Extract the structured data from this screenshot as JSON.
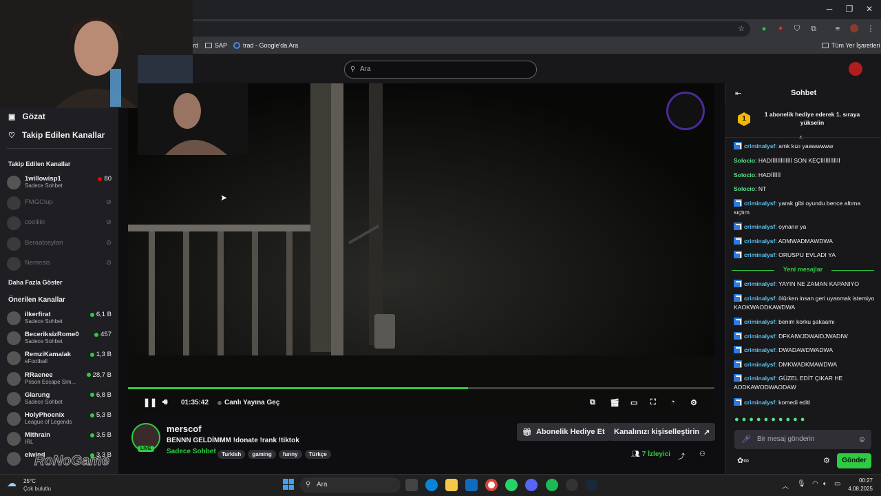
{
  "browser": {
    "bookmarks": [
      {
        "label": "rd"
      },
      {
        "label": "SAP"
      },
      {
        "label": "trad - Google'da Ara"
      }
    ],
    "all_bookmarks": "Tüm Yer İşaretleri"
  },
  "header": {
    "search_placeholder": "Ara"
  },
  "sidebar": {
    "browse": "Gözat",
    "following": "Takip Edilen Kanallar",
    "followed_title": "Takip Edilen Kanallar",
    "followed": [
      {
        "name": "1willowisp1",
        "sub": "Sadece Sohbet",
        "count": "80",
        "live": true
      },
      {
        "name": "FMGClup",
        "sub": "",
        "count": "",
        "live": false
      },
      {
        "name": "cooliiin",
        "sub": "",
        "count": "",
        "live": false
      },
      {
        "name": "Beraatceylan",
        "sub": "",
        "count": "",
        "live": false
      },
      {
        "name": "Nemesis",
        "sub": "",
        "count": "",
        "live": false
      }
    ],
    "show_more": "Daha Fazla Göster",
    "recommended_title": "Önerilen Kanallar",
    "recommended": [
      {
        "name": "ilkerfirat",
        "sub": "Sadece Sohbet",
        "count": "6,1 B"
      },
      {
        "name": "BeceriksizRome0",
        "sub": "Sadece Sohbet",
        "count": "457"
      },
      {
        "name": "RemziKamalak",
        "sub": "eFootball",
        "count": "1,3 B"
      },
      {
        "name": "RRaenee",
        "sub": "Prison Escape Sim...",
        "count": "28,7 B"
      },
      {
        "name": "Glarung",
        "sub": "Sadece Sohbet",
        "count": "6,8 B"
      },
      {
        "name": "HolyPhoenix",
        "sub": "League of Legends",
        "count": "5,3 B"
      },
      {
        "name": "Mithrain",
        "sub": "IRL",
        "count": "3,5 B"
      },
      {
        "name": "elwind",
        "sub": "",
        "count": "3,3 B"
      }
    ]
  },
  "player": {
    "progress": 0.58,
    "time": "01:35:42",
    "go_live": "Canlı Yayına Geç"
  },
  "stream": {
    "channel": "merscof",
    "title": "BENNN GELDİMMM !donate !rank !tiktok",
    "category": "Sadece Sohbet",
    "live_badge": "LIVE",
    "tags": [
      "Turkish",
      "gaming",
      "funny",
      "Türkçe"
    ],
    "gift_button": "Abonelik Hediye Et",
    "customize_button": "Kanalınızı kişiselleştirin",
    "viewers_count": "7",
    "viewers_label": "İzleyici"
  },
  "chat": {
    "title": "Sohbet",
    "pinned_rank": "1",
    "pinned_text": "1 abonelik hediye ederek 1. sıraya yükselin",
    "new_messages": "Yeni mesajlar",
    "messages": [
      {
        "user": "criminalysf",
        "text": ": amk kızı yaawwwww",
        "badge": true
      },
      {
        "user": "Solocio",
        "text": ": HADİİİİİİİİİİİİİ SON KEÇİİİİİİİİİİİİ",
        "badge": false
      },
      {
        "user": "Solocio",
        "text": ": HADİİİİİİ",
        "badge": false
      },
      {
        "user": "Solocio",
        "text": ": NT",
        "badge": false
      },
      {
        "user": "criminalysf",
        "text": ": yarak gibi oyundu bence altıma sıçtım",
        "badge": true
      },
      {
        "user": "criminalysf",
        "text": ": oynanır ya",
        "badge": true
      },
      {
        "user": "criminalysf",
        "text": ": ADMWADMAWDWA",
        "badge": true
      },
      {
        "user": "criminalysf",
        "text": ": ORUSPU EVLADI YA",
        "badge": true
      },
      {
        "user": "criminalysf",
        "text": ": YAYIN NE ZAMAN KAPANIYO",
        "badge": true
      },
      {
        "user": "criminalysf",
        "text": ": ölürken insan geri uyanmak istemiyo KAOKWAODKAWDWA",
        "badge": true
      },
      {
        "user": "criminalysf",
        "text": ": benim korku şakaamı",
        "badge": true
      },
      {
        "user": "criminalysf",
        "text": ": DFKAIWJDWAIDJWADIW",
        "badge": true
      },
      {
        "user": "criminalysf",
        "text": ": DWADAWDWADWA",
        "badge": true
      },
      {
        "user": "criminalysf",
        "text": ": DMKWADKMAWDWA",
        "badge": true
      },
      {
        "user": "criminalysf",
        "text": ": GÜZEL EDİT ÇIKAR HE AODKAWODWAODAW",
        "badge": true
      },
      {
        "user": "criminalysf",
        "text": ": komedi editi",
        "badge": true
      }
    ],
    "input_placeholder": "Bir mesaj gönderin",
    "send": "Gönder"
  },
  "taskbar": {
    "weather_temp": "25°C",
    "weather_text": "Çok bulutlu",
    "search_placeholder": "Ara",
    "time": "00:27",
    "date": "4.08.2025"
  },
  "watermark": "RoNoGame",
  "colors": {
    "accent": "#2ecc40",
    "live": "#eb0400",
    "chat_user": "#5ac3f0",
    "chat_user2": "#57e389"
  }
}
